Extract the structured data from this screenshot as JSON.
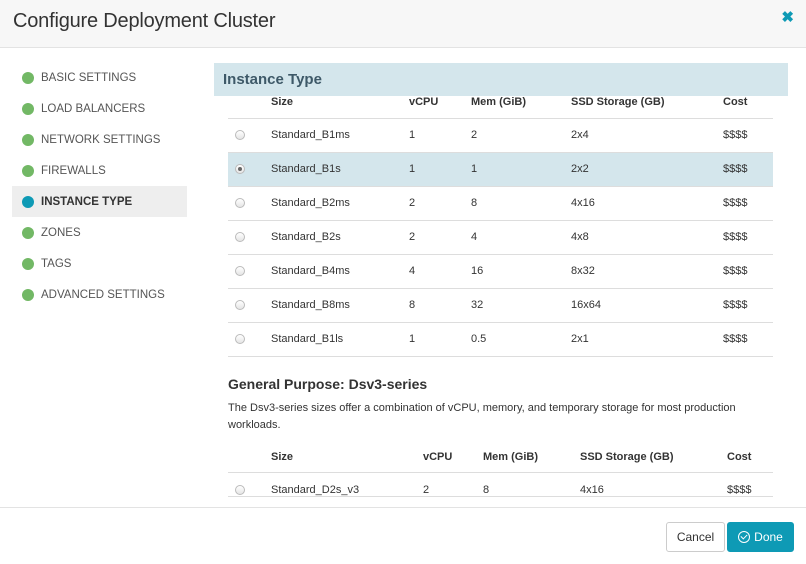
{
  "header": {
    "title": "Configure Deployment Cluster",
    "close_icon": "close-icon"
  },
  "sidebar": {
    "items": [
      {
        "label": "BASIC SETTINGS",
        "status": "complete"
      },
      {
        "label": "LOAD BALANCERS",
        "status": "complete"
      },
      {
        "label": "NETWORK SETTINGS",
        "status": "complete"
      },
      {
        "label": "FIREWALLS",
        "status": "complete"
      },
      {
        "label": "INSTANCE TYPE",
        "status": "active"
      },
      {
        "label": "ZONES",
        "status": "complete"
      },
      {
        "label": "TAGS",
        "status": "complete"
      },
      {
        "label": "ADVANCED SETTINGS",
        "status": "complete"
      }
    ]
  },
  "main": {
    "section_title": "Instance Type",
    "columns": [
      "Size",
      "vCPU",
      "Mem (GiB)",
      "SSD Storage (GB)",
      "Cost"
    ],
    "rows": [
      {
        "size": "Standard_B1ms",
        "vcpu": "1",
        "mem": "2",
        "ssd": "2x4",
        "cost": "$$$$",
        "selected": false
      },
      {
        "size": "Standard_B1s",
        "vcpu": "1",
        "mem": "1",
        "ssd": "2x2",
        "cost": "$$$$",
        "selected": true
      },
      {
        "size": "Standard_B2ms",
        "vcpu": "2",
        "mem": "8",
        "ssd": "4x16",
        "cost": "$$$$",
        "selected": false
      },
      {
        "size": "Standard_B2s",
        "vcpu": "2",
        "mem": "4",
        "ssd": "4x8",
        "cost": "$$$$",
        "selected": false
      },
      {
        "size": "Standard_B4ms",
        "vcpu": "4",
        "mem": "16",
        "ssd": "8x32",
        "cost": "$$$$",
        "selected": false
      },
      {
        "size": "Standard_B8ms",
        "vcpu": "8",
        "mem": "32",
        "ssd": "16x64",
        "cost": "$$$$",
        "selected": false
      },
      {
        "size": "Standard_B1ls",
        "vcpu": "1",
        "mem": "0.5",
        "ssd": "2x1",
        "cost": "$$$$",
        "selected": false
      }
    ],
    "dsv3": {
      "title": "General Purpose: Dsv3-series",
      "description": "The Dsv3-series sizes offer a combination of vCPU, memory, and temporary storage for most production workloads.",
      "columns": [
        "Size",
        "vCPU",
        "Mem (GiB)",
        "SSD Storage (GB)",
        "Cost"
      ],
      "rows": [
        {
          "size": "Standard_D2s_v3",
          "vcpu": "2",
          "mem": "8",
          "ssd": "4x16",
          "cost": "$$$$",
          "selected": false
        }
      ]
    }
  },
  "footer": {
    "cancel_label": "Cancel",
    "done_label": "Done"
  },
  "colors": {
    "accent": "#0e9ab5",
    "complete": "#72b865",
    "selected_row": "#d4e6ec"
  }
}
